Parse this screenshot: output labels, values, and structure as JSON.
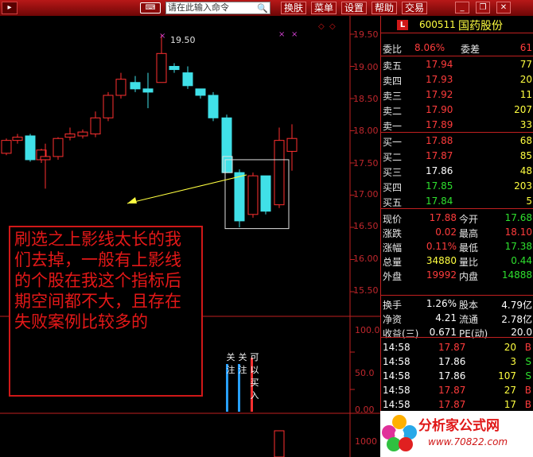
{
  "toolbar": {
    "command_placeholder": "请在此输入命令",
    "menus": [
      "换肤",
      "菜单",
      "设置",
      "帮助",
      "交易"
    ],
    "watermark": "www.70822.com"
  },
  "chart": {
    "price_axis": [
      "19.50",
      "19.00",
      "18.50",
      "18.00",
      "17.50",
      "17.00",
      "16.50",
      "16.00",
      "15.50"
    ],
    "high_marker": "19.50",
    "indicator_axis": [
      "100.0",
      "50.0",
      "0.00"
    ],
    "volume_axis": [
      "1000"
    ],
    "annotation": "刷选之上影线太长的我们去掉，一般有上影线的个股在我这个指标后期空间都不大，且存在失败案例比较多的",
    "signals": [
      {
        "label": "关注",
        "color": "#28a0ff"
      },
      {
        "label": "关注",
        "color": "#28a0ff"
      },
      {
        "label": "可以买入",
        "color": "#ff3030"
      }
    ]
  },
  "quote": {
    "code": "600511",
    "name": "国药股份",
    "wei_bi_label": "委比",
    "wei_bi": "8.06%",
    "wei_cha_label": "委差",
    "wei_cha": "61",
    "sells": [
      {
        "label": "卖五",
        "price": "17.94",
        "vol": "77"
      },
      {
        "label": "卖四",
        "price": "17.93",
        "vol": "20"
      },
      {
        "label": "卖三",
        "price": "17.92",
        "vol": "11"
      },
      {
        "label": "卖二",
        "price": "17.90",
        "vol": "207"
      },
      {
        "label": "卖一",
        "price": "17.89",
        "vol": "33"
      }
    ],
    "buys": [
      {
        "label": "买一",
        "price": "17.88",
        "vol": "68"
      },
      {
        "label": "买二",
        "price": "17.87",
        "vol": "85"
      },
      {
        "label": "买三",
        "price": "17.86",
        "vol": "48"
      },
      {
        "label": "买四",
        "price": "17.85",
        "vol": "203"
      },
      {
        "label": "买五",
        "price": "17.84",
        "vol": "5"
      }
    ],
    "stats": [
      {
        "l1": "现价",
        "v1": "17.88",
        "l2": "今开",
        "v2": "17.68"
      },
      {
        "l1": "涨跌",
        "v1": "0.02",
        "l2": "最高",
        "v2": "18.10"
      },
      {
        "l1": "涨幅",
        "v1": "0.11%",
        "l2": "最低",
        "v2": "17.38"
      },
      {
        "l1": "总量",
        "v1": "34880",
        "l2": "量比",
        "v2": "0.44"
      },
      {
        "l1": "外盘",
        "v1": "19992",
        "l2": "内盘",
        "v2": "14888"
      }
    ],
    "stats2": [
      {
        "l1": "换手",
        "v1": "1.26%",
        "l2": "股本",
        "v2": "4.79亿"
      },
      {
        "l1": "净资",
        "v1": "4.21",
        "l2": "流通",
        "v2": "2.78亿"
      },
      {
        "l1": "收益(三)",
        "v1": "0.671",
        "l2": "PE(动)",
        "v2": "20.0"
      }
    ],
    "ticks": [
      {
        "time": "14:58",
        "price": "17.87",
        "vol": "20",
        "side": "B"
      },
      {
        "time": "14:58",
        "price": "17.86",
        "vol": "3",
        "side": "S"
      },
      {
        "time": "14:58",
        "price": "17.86",
        "vol": "107",
        "side": "S"
      },
      {
        "time": "14:58",
        "price": "17.87",
        "vol": "27",
        "side": "B"
      },
      {
        "time": "14:58",
        "price": "17.87",
        "vol": "17",
        "side": "B"
      },
      {
        "time": "14:58",
        "price": "17.87",
        "vol": "",
        "side": ""
      }
    ]
  },
  "logo": {
    "title": "分析家公式网",
    "url": "www.70822.com"
  }
}
